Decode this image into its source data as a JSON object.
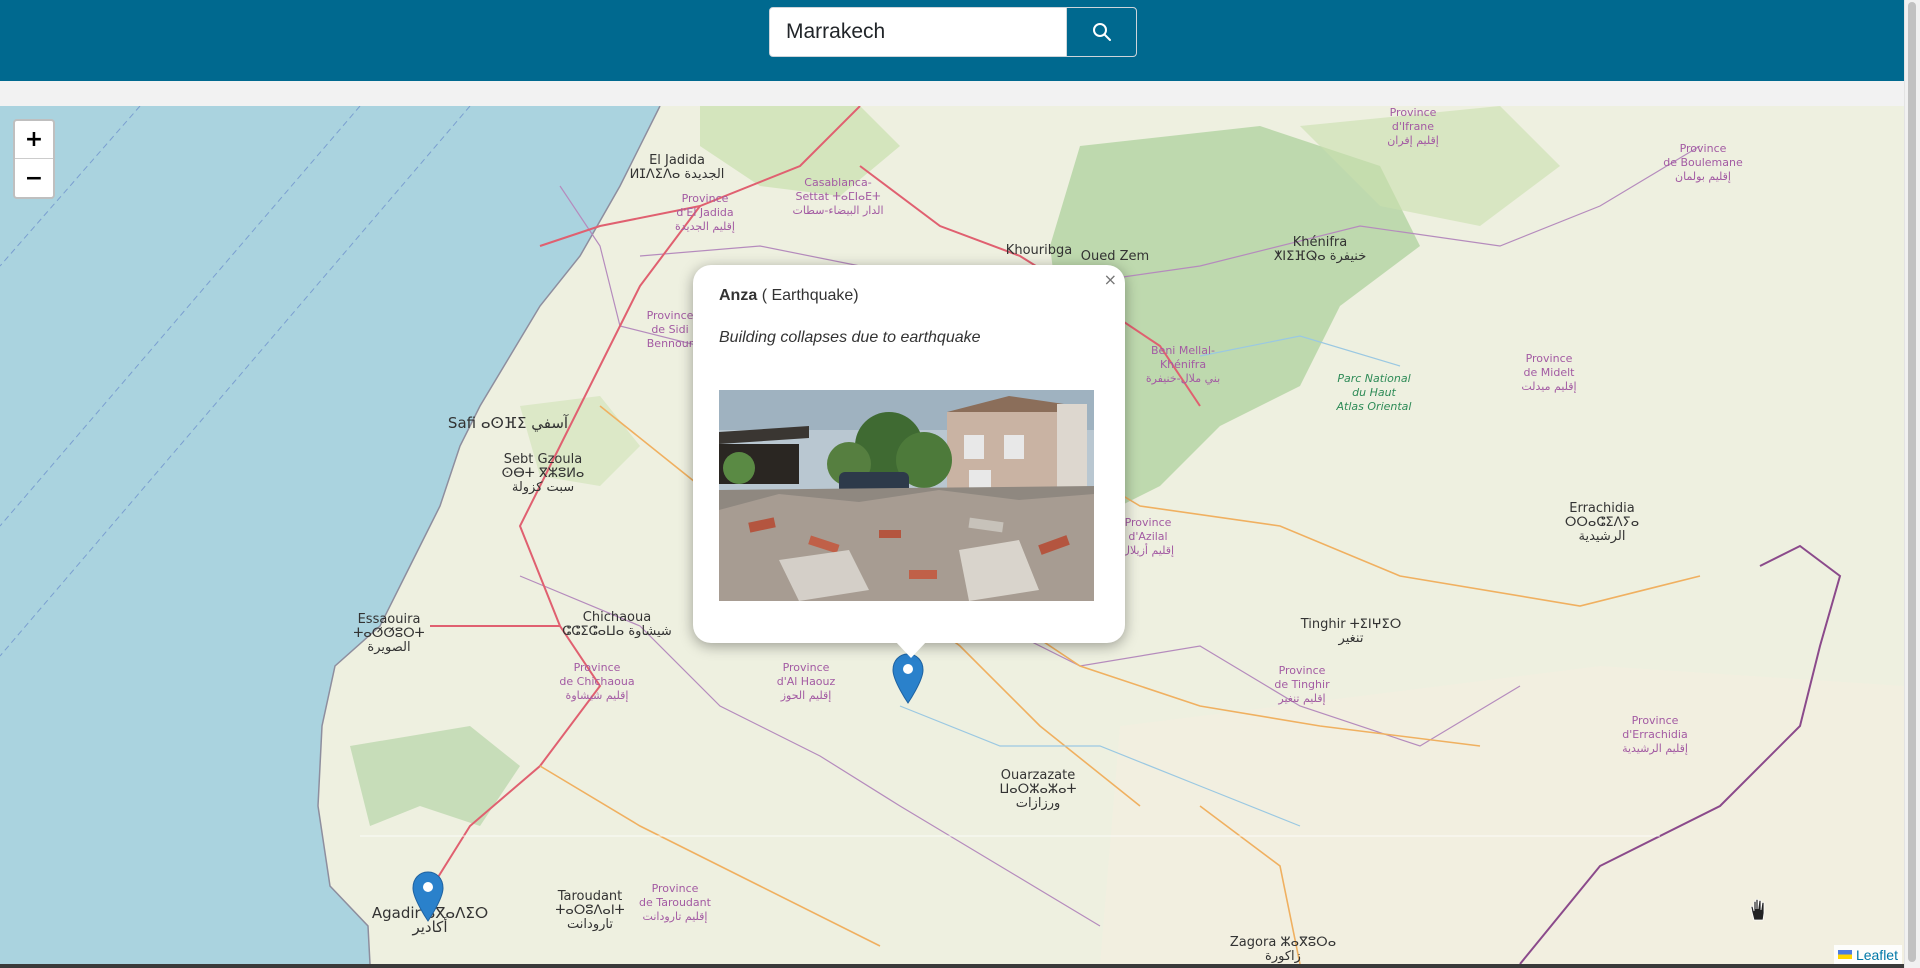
{
  "search": {
    "value": "Marrakech",
    "button_icon": "search-icon"
  },
  "zoom": {
    "in_label": "+",
    "out_label": "−"
  },
  "popup": {
    "place": "Anza",
    "type": "( Earthquake)",
    "description": "Building collapses due to earthquake",
    "close_label": "×",
    "image_alt": "photo of collapsed building rubble"
  },
  "attribution": {
    "label": "Leaflet"
  },
  "map_labels": [
    {
      "text": "El Jadida",
      "sub": "ⵍⵊⴷⵉⴷⴰ الجديدة",
      "kind": "town"
    },
    {
      "text": "Province",
      "sub": "d'El Jadida",
      "sub2": "إقليم الجديدة",
      "kind": "region"
    },
    {
      "text": "Casablanca-",
      "sub": "Settat ⵜⴰⵎⵏⴰⴹⵜ",
      "sub2": "الدار البيضاء-سطات",
      "kind": "region"
    },
    {
      "text": "Khouribga",
      "kind": "town"
    },
    {
      "text": "Oued Zem",
      "kind": "town"
    },
    {
      "text": "Province",
      "sub": "d'Ifrane",
      "sub2": "إقليم إفران",
      "kind": "region"
    },
    {
      "text": "Province",
      "sub": "de Boulemane",
      "sub2": "إقليم بولمان",
      "kind": "region"
    },
    {
      "text": "Khénifra",
      "sub": "ⵅⵏⵉⴼⵕⴰ خنيفرة",
      "kind": "town"
    },
    {
      "text": "Beni Mellal-",
      "sub": "Khénifra",
      "sub2": "بني ملال-خنيفرة",
      "kind": "region"
    },
    {
      "text": "Parc National",
      "sub": "du Haut",
      "sub2": "Atlas Oriental",
      "kind": "park"
    },
    {
      "text": "Province",
      "sub": "de Midelt",
      "sub2": "إقليم ميدلت",
      "kind": "region"
    },
    {
      "text": "Province",
      "sub": "de Sidi",
      "sub2": "Bennour",
      "kind": "region"
    },
    {
      "text": "Safi ⴰⵙⴼⵉ آسفي",
      "kind": "town"
    },
    {
      "text": "Sebt Gzoula",
      "sub": "ⵙⴱⵜ ⴳⵣⵓⵍⴰ",
      "sub2": "سبت كزولة",
      "kind": "town"
    },
    {
      "text": "Errachidia",
      "sub": "ⵔⵔⴰⵛⵉⴷⵢⴰ",
      "sub2": "الرشيدية",
      "kind": "town"
    },
    {
      "text": "Province",
      "sub": "d'Azilal",
      "sub2": "إقليم أزيلال",
      "kind": "region"
    },
    {
      "text": "Essaouira",
      "sub": "ⵜⴰⵚⵚⵓⵔⵜ",
      "sub2": "الصويرة",
      "kind": "town"
    },
    {
      "text": "Chichaoua",
      "sub": "ⵛⵛⵉⵛⴰⵡⴰ شيشاوة",
      "kind": "town"
    },
    {
      "text": "Tinghir ⵜⵉⵏⵖⵉⵔ",
      "sub": "تنغير",
      "kind": "town"
    },
    {
      "text": "Province",
      "sub": "de Chichaoua",
      "sub2": "إقليم شيشاوة",
      "kind": "region"
    },
    {
      "text": "Province",
      "sub": "d'Al Haouz",
      "sub2": "إقليم الحوز",
      "kind": "region"
    },
    {
      "text": "Province",
      "sub": "de Tinghir",
      "sub2": "إقليم تنغير",
      "kind": "region"
    },
    {
      "text": "Province",
      "sub": "d'Errachidia",
      "sub2": "إقليم الرشيدية",
      "kind": "region"
    },
    {
      "text": "Ouarzazate",
      "sub": "ⵡⴰⵔⵣⴰⵣⴰⵜ",
      "sub2": "ورزازات",
      "kind": "town"
    },
    {
      "text": "Agadir ⴰⴳⴰⴷⵉⵔ",
      "sub": "أكادير",
      "kind": "town"
    },
    {
      "text": "Taroudant",
      "sub": "ⵜⴰⵔⵓⴷⴰⵏⵜ",
      "sub2": "تارودانت",
      "kind": "town"
    },
    {
      "text": "Province",
      "sub": "de Taroudant",
      "sub2": "إقليم تارودانت",
      "kind": "region"
    },
    {
      "text": "Zagora ⵣⴰⴳⵓⵔⴰ",
      "sub": "زاكورة",
      "kind": "town"
    }
  ],
  "colors": {
    "header": "#00698f",
    "sea": "#aad3df",
    "land": "#eef0e0",
    "forest": "#add19e",
    "marker": "#2a81cb"
  }
}
